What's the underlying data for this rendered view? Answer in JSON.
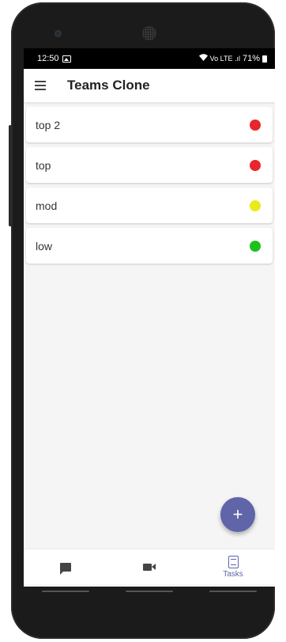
{
  "status_bar": {
    "time": "12:50",
    "indicators": "Vo LTE .ıl",
    "battery": "71%"
  },
  "app_bar": {
    "title": "Teams Clone",
    "menu_icon": "menu-icon"
  },
  "tasks": [
    {
      "label": "top 2",
      "priority_color": "#e8262d"
    },
    {
      "label": "top",
      "priority_color": "#e8262d"
    },
    {
      "label": "mod",
      "priority_color": "#eaea18"
    },
    {
      "label": "low",
      "priority_color": "#1ec01e"
    }
  ],
  "fab": {
    "label": "+"
  },
  "bottom_nav": {
    "items": [
      {
        "icon": "chat-icon",
        "label": ""
      },
      {
        "icon": "video-camera-icon",
        "label": ""
      },
      {
        "icon": "tasks-icon",
        "label": "Tasks"
      }
    ]
  },
  "colors": {
    "accent": "#6064a8",
    "fab": "#6064a8"
  }
}
